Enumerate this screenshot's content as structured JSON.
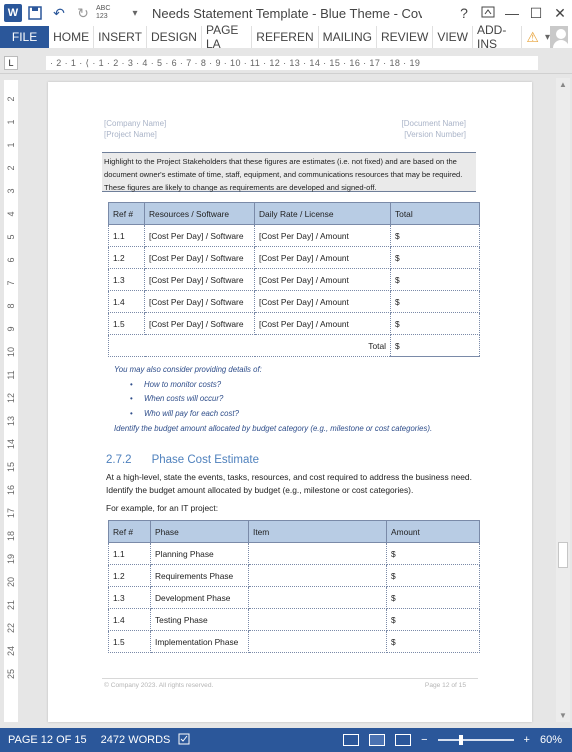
{
  "window": {
    "title": "Needs Statement Template - Blue Theme - Cov...",
    "help": "?",
    "minimize": "—",
    "maximize": "☐",
    "close": "✕"
  },
  "quick_access": {
    "logo": "W",
    "save_icon": "💾",
    "undo_icon": "↶",
    "redo_icon": "↻",
    "spell_icon": "ABC 123",
    "more_icon": "▾"
  },
  "ribbon": {
    "file": "FILE",
    "tabs": [
      "HOME",
      "INSERT",
      "DESIGN",
      "PAGE LA",
      "REFEREN",
      "MAILING",
      "REVIEW",
      "VIEW",
      "ADD-INS"
    ],
    "warning_icon": "⚠",
    "expand_icon": "▾"
  },
  "ruler": {
    "tab_selector": "L",
    "h_numbers": "· 2 · 1 · ⟨ · 1 · 2 · 3 · 4 · 5 · 6 · 7 · 8 · 9 · 10 · 11 · 12 · 13 · 14 · 15 · 16 · 17 · 18 · 19",
    "v_numbers": [
      "2",
      "1",
      "1",
      "2",
      "3",
      "4",
      "5",
      "6",
      "7",
      "8",
      "9",
      "10",
      "11",
      "12",
      "13",
      "14",
      "15",
      "16",
      "17",
      "18",
      "19",
      "20",
      "21",
      "22",
      "24",
      "25"
    ]
  },
  "document": {
    "header": {
      "company": "[Company Name]",
      "project": "[Project Name]",
      "document": "[Document Name]",
      "version": "[Version Number]"
    },
    "highlight": "Highlight to the Project Stakeholders that these figures are estimates (i.e. not fixed) and are based on the document owner's estimate of time, staff, equipment, and communications resources that may be required. These figures are likely to change as requirements are developed and signed-off.",
    "table1": {
      "headers": [
        "Ref #",
        "Resources / Software",
        "Daily Rate / License",
        "Total"
      ],
      "rows": [
        [
          "1.1",
          "[Cost Per Day] / Software",
          "[Cost Per Day] / Amount",
          "$"
        ],
        [
          "1.2",
          "[Cost Per Day] / Software",
          "[Cost Per Day] / Amount",
          "$"
        ],
        [
          "1.3",
          "[Cost Per Day] / Software",
          "[Cost Per Day] / Amount",
          "$"
        ],
        [
          "1.4",
          "[Cost Per Day] / Software",
          "[Cost Per Day] / Amount",
          "$"
        ],
        [
          "1.5",
          "[Cost Per Day] / Software",
          "[Cost Per Day] / Amount",
          "$"
        ]
      ],
      "total_label": "Total",
      "total_value": "$"
    },
    "notes": {
      "intro": "You may also consider providing details of:",
      "bullets": [
        "How to monitor costs?",
        "When costs will occur?",
        "Who will pay for each cost?"
      ],
      "outro": "Identify the budget amount allocated by budget category (e.g., milestone or cost categories)."
    },
    "section": {
      "number": "2.7.2",
      "title": "Phase Cost Estimate"
    },
    "para1": "At a high-level, state the events, tasks, resources, and cost required to address the business need. Identify the budget amount allocated by budget (e.g., milestone or cost categories).",
    "para2": "For example, for an IT project:",
    "table2": {
      "headers": [
        "Ref #",
        "Phase",
        "Item",
        "Amount"
      ],
      "rows": [
        [
          "1.1",
          "Planning Phase",
          "",
          "$"
        ],
        [
          "1.2",
          "Requirements Phase",
          "",
          "$"
        ],
        [
          "1.3",
          "Development Phase",
          "",
          "$"
        ],
        [
          "1.4",
          "Testing Phase",
          "",
          "$"
        ],
        [
          "1.5",
          "Implementation Phase",
          "",
          "$"
        ]
      ]
    },
    "footer": {
      "left": "© Company 2023. All rights reserved.",
      "right": "Page 12 of 15"
    }
  },
  "statusbar": {
    "page": "PAGE 12 OF 15",
    "words": "2472 WORDS",
    "zoom_minus": "−",
    "zoom_plus": "+",
    "zoom": "60%",
    "zoom_fraction": 0.6
  },
  "colors": {
    "brand": "#2b579a",
    "table_header": "#b8cce4",
    "note_text": "#2e4d8a",
    "section_heading": "#4f81bd"
  }
}
